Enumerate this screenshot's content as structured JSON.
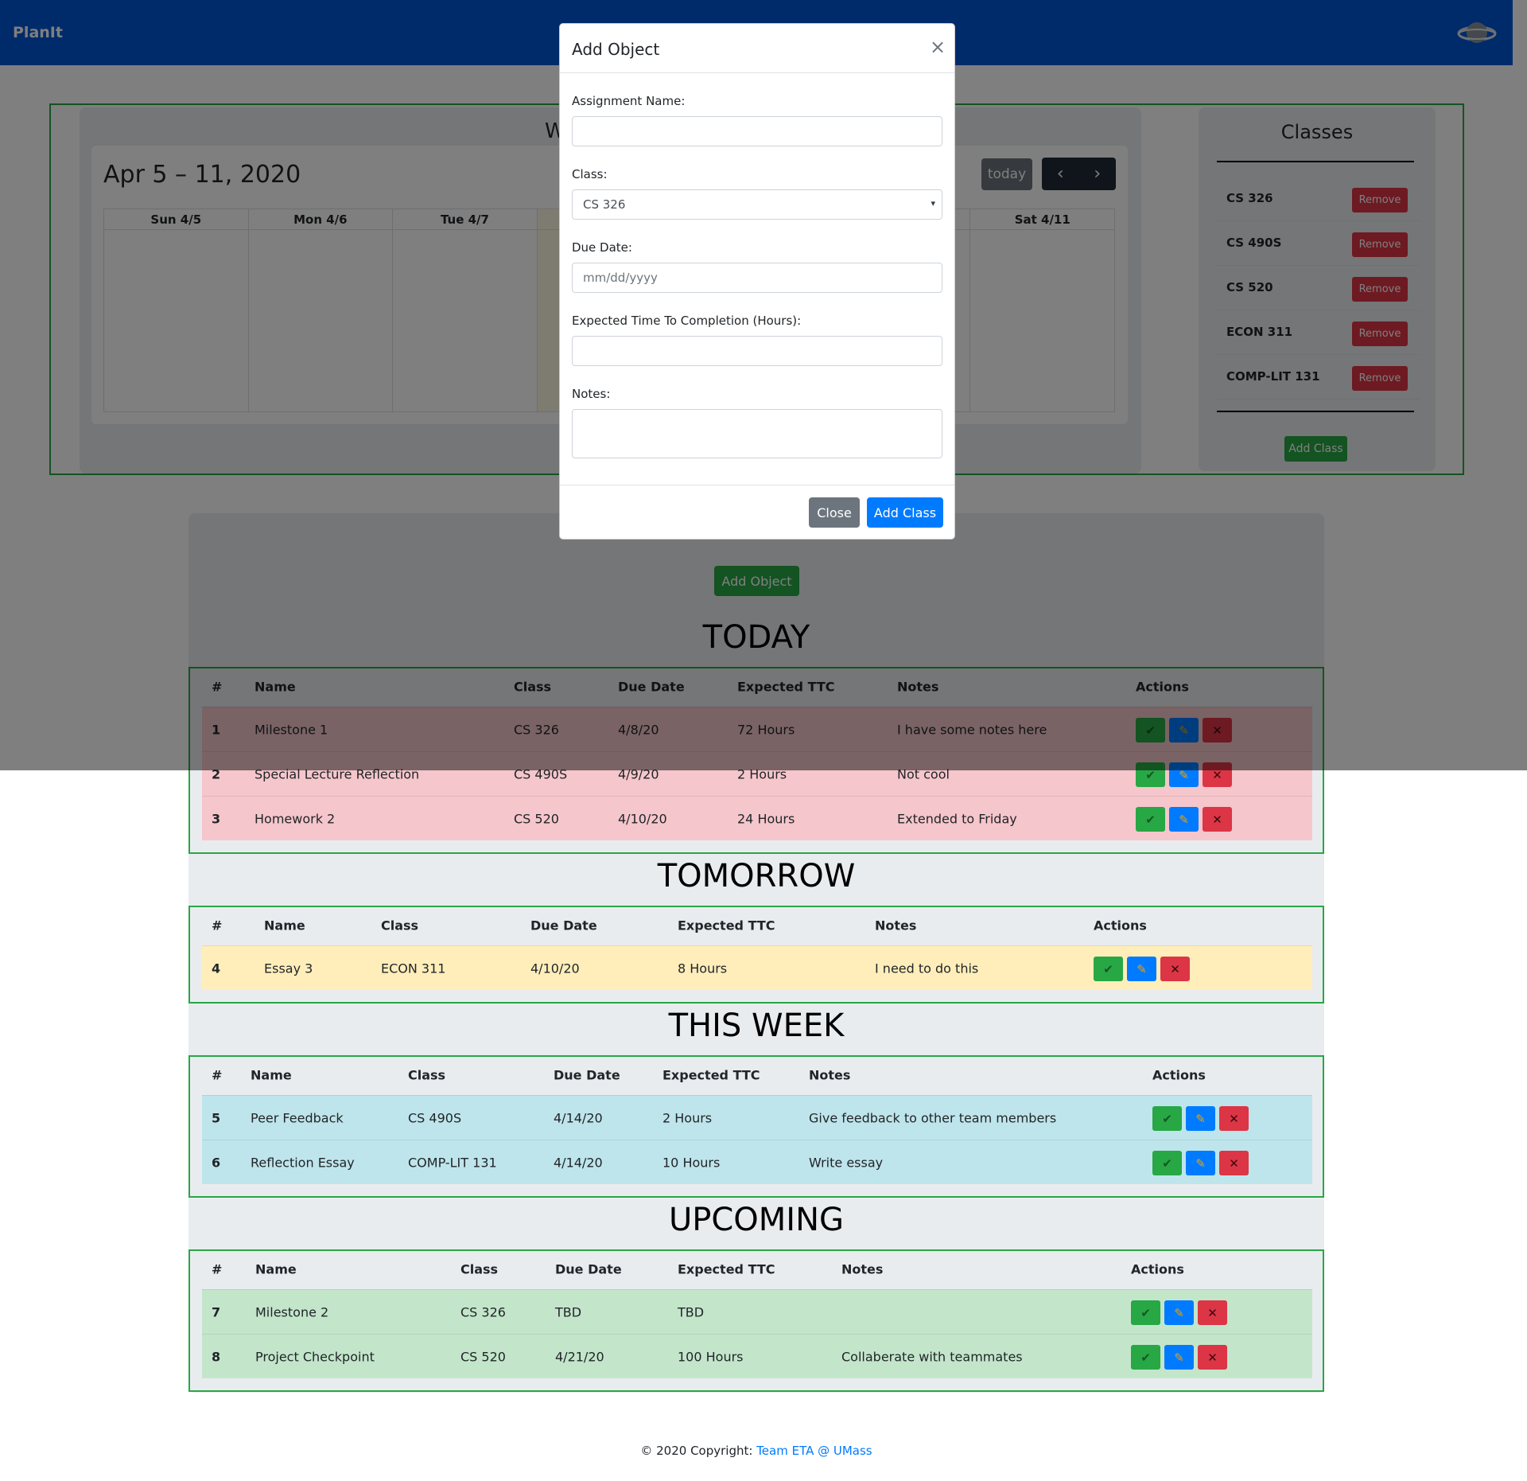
{
  "app": {
    "brand": "PlanIt",
    "profile_icon": "planet-icon"
  },
  "calendar": {
    "heading": "W",
    "title": "Apr 5 – 11, 2020",
    "today_label": "today",
    "prev_icon": "chevron-left-icon",
    "next_icon": "chevron-right-icon",
    "days": [
      "Sun 4/5",
      "Mon 4/6",
      "Tue 4/7",
      "",
      "",
      "",
      "Sat 4/11"
    ]
  },
  "classes": {
    "title": "Classes",
    "remove_label": "Remove",
    "items": [
      "CS 326",
      "CS 490S",
      "CS 520",
      "ECON 311",
      "COMP-LIT 131"
    ],
    "add_label": "Add Class"
  },
  "assignments": {
    "add_object_label": "Add Object",
    "columns": [
      "#",
      "Name",
      "Class",
      "Due Date",
      "Expected TTC",
      "Notes",
      "Actions"
    ],
    "sections": [
      {
        "title": "TODAY",
        "rows": [
          {
            "num": "1",
            "name": "Milestone 1",
            "class": "CS 326",
            "due": "4/8/20",
            "ttc": "72 Hours",
            "notes": "I have some notes here"
          },
          {
            "num": "2",
            "name": "Special Lecture Reflection",
            "class": "CS 490S",
            "due": "4/9/20",
            "ttc": "2 Hours",
            "notes": "Not cool"
          },
          {
            "num": "3",
            "name": "Homework 2",
            "class": "CS 520",
            "due": "4/10/20",
            "ttc": "24 Hours",
            "notes": "Extended to Friday"
          }
        ]
      },
      {
        "title": "TOMORROW",
        "rows": [
          {
            "num": "4",
            "name": "Essay 3",
            "class": "ECON 311",
            "due": "4/10/20",
            "ttc": "8 Hours",
            "notes": "I need to do this"
          }
        ]
      },
      {
        "title": "THIS WEEK",
        "rows": [
          {
            "num": "5",
            "name": "Peer Feedback",
            "class": "CS 490S",
            "due": "4/14/20",
            "ttc": "2 Hours",
            "notes": "Give feedback to other team members"
          },
          {
            "num": "6",
            "name": "Reflection Essay",
            "class": "COMP-LIT 131",
            "due": "4/14/20",
            "ttc": "10 Hours",
            "notes": "Write essay"
          }
        ]
      },
      {
        "title": "UPCOMING",
        "rows": [
          {
            "num": "7",
            "name": "Milestone 2",
            "class": "CS 326",
            "due": "TBD",
            "ttc": "TBD",
            "notes": ""
          },
          {
            "num": "8",
            "name": "Project Checkpoint",
            "class": "CS 520",
            "due": "4/21/20",
            "ttc": "100 Hours",
            "notes": "Collaberate with teammates"
          }
        ]
      }
    ],
    "action_icons": {
      "done": "checkmark-icon",
      "edit": "pencil-icon",
      "delete": "x-icon"
    }
  },
  "modal": {
    "title": "Add Object",
    "close_glyph": "×",
    "fields": {
      "assignment_name_label": "Assignment Name:",
      "assignment_name_value": "",
      "class_label": "Class:",
      "class_value": "CS 326",
      "due_date_label": "Due Date:",
      "due_date_placeholder": "mm/dd/yyyy",
      "ttc_label": "Expected Time To Completion (Hours):",
      "ttc_value": "",
      "notes_label": "Notes:",
      "notes_value": ""
    },
    "close_label": "Close",
    "submit_label": "Add Class"
  },
  "footer": {
    "text": "© 2020 Copyright: ",
    "link": "Team ETA @ UMass"
  },
  "colors": {
    "navbar": "#0056d6",
    "success": "#28a745",
    "danger": "#dc3545",
    "primary": "#007bff"
  }
}
